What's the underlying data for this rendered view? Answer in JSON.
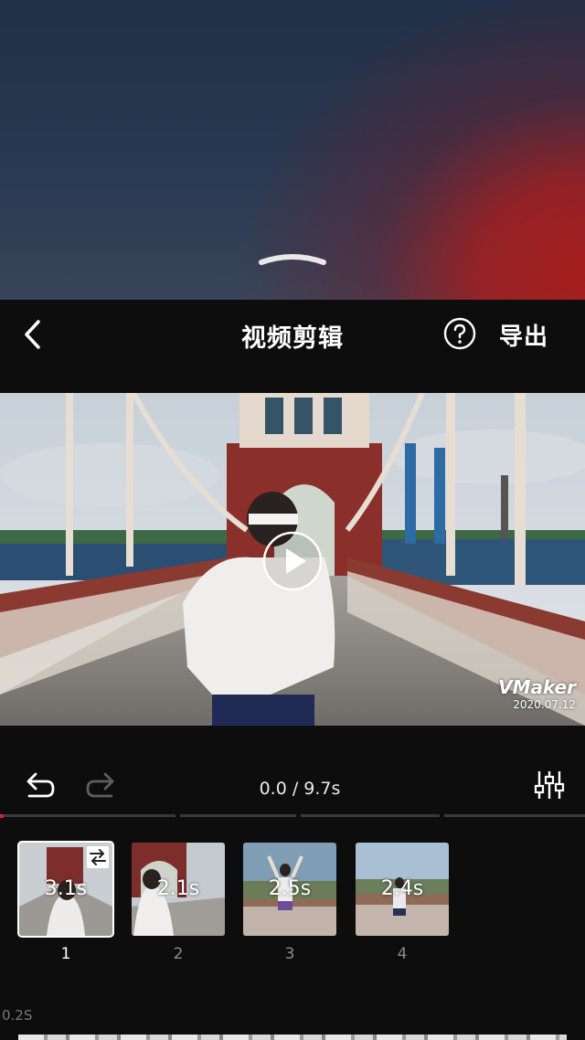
{
  "header": {
    "title": "视频剪辑",
    "export_label": "导出"
  },
  "icons": {
    "back": "chevron-left-icon",
    "help": "question-circle-icon",
    "play": "play-icon",
    "undo": "undo-icon",
    "redo": "redo-icon",
    "adjust": "sliders-icon",
    "swap": "swap-icon"
  },
  "preview": {
    "watermark_logo": "VMaker",
    "watermark_date": "2020.07.12"
  },
  "playback": {
    "time": "0.0 / 9.7s",
    "progress_fraction": 0.0
  },
  "clips": [
    {
      "duration": "3.1s",
      "index": "1",
      "selected": true
    },
    {
      "duration": "2.1s",
      "index": "2",
      "selected": false
    },
    {
      "duration": "2.5s",
      "index": "3",
      "selected": false
    },
    {
      "duration": "2.4s",
      "index": "4",
      "selected": false
    }
  ],
  "transition": {
    "label": "0.2S"
  },
  "colors": {
    "background": "#0d0d0d",
    "accent_red": "#e02020",
    "text_primary": "#ffffff",
    "text_muted": "#8a8a8a"
  }
}
